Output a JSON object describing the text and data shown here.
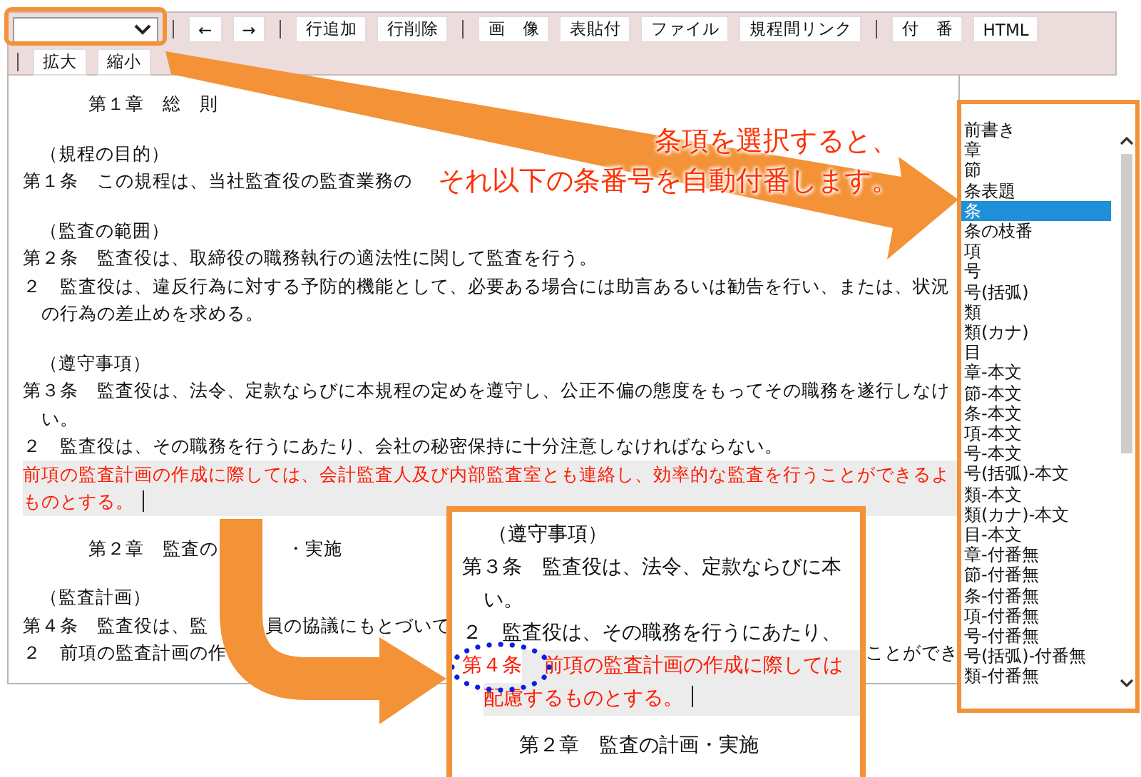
{
  "toolbar": {
    "rows": [
      [
        {
          "kind": "dropdown"
        },
        {
          "kind": "separator"
        },
        {
          "kind": "button",
          "label": "←"
        },
        {
          "kind": "button",
          "label": "→"
        },
        {
          "kind": "separator"
        },
        {
          "kind": "button",
          "label": "行追加"
        },
        {
          "kind": "button",
          "label": "行削除"
        },
        {
          "kind": "separator"
        },
        {
          "kind": "button",
          "label": "画　像"
        },
        {
          "kind": "button",
          "label": "表貼付"
        },
        {
          "kind": "button",
          "label": "ファイル"
        },
        {
          "kind": "button",
          "label": "規程間リンク"
        },
        {
          "kind": "separator"
        },
        {
          "kind": "button",
          "label": "付　番"
        },
        {
          "kind": "button",
          "label": "HTML"
        }
      ],
      [
        {
          "kind": "separator"
        },
        {
          "kind": "button",
          "label": "拡大"
        },
        {
          "kind": "button",
          "label": "縮小"
        }
      ]
    ]
  },
  "document": {
    "lines": [
      {
        "kind": "chapter",
        "parts": [
          "第１章　総　則"
        ]
      },
      {
        "kind": "caption",
        "parts": [
          "（規程の目的）"
        ]
      },
      {
        "kind": "article",
        "parts": [
          "第１条　この規程は、当社監査役の監査業務の"
        ]
      },
      {
        "kind": "caption",
        "parts": [
          "（監査の範囲）"
        ]
      },
      {
        "kind": "article",
        "parts": [
          "第２条　監査役は、取締役の職務執行の適法性に関して監査を行う。"
        ]
      },
      {
        "kind": "article",
        "parts": [
          "２　監査役は、違反行為に対する予防的機能として、必要ある場合には助言あるいは勧告を行い、または、状況"
        ]
      },
      {
        "kind": "continuation",
        "parts": [
          "の行為の差止めを求める。"
        ]
      },
      {
        "kind": "caption",
        "parts": [
          "（遵守事項）"
        ]
      },
      {
        "kind": "article",
        "parts": [
          "第３条　監査役は、法令、定款ならびに本規程の定めを遵守し、公正不偏の態度をもってその職務を遂行しなけ"
        ]
      },
      {
        "kind": "continuation",
        "parts": [
          "い。"
        ]
      },
      {
        "kind": "article",
        "parts": [
          "２　監査役は、その職務を行うにあたり、会社の秘密保持に十分注意しなければならない。"
        ]
      },
      {
        "kind": "highlight",
        "parts": [
          "前項の監査計画の作成に際しては、会計監査人及び内部監査室とも連絡し、効率的な監査を行うことができるよ"
        ]
      },
      {
        "kind": "highlight",
        "parts": [
          "ものとする。"
        ],
        "caret": true
      },
      {
        "kind": "chapter",
        "parts": [
          "第２章　監査の",
          "・実施"
        ]
      },
      {
        "kind": "caption",
        "parts": [
          "（監査計画）"
        ]
      },
      {
        "kind": "article",
        "parts": [
          "第４条　監査役は、監",
          "員の協議にもとづいて"
        ]
      },
      {
        "kind": "article",
        "parts": [
          "２　前項の監査計画の作",
          "ことができ"
        ]
      }
    ]
  },
  "callout": {
    "lines": [
      "条項を選択すると、",
      "それ以下の条番号を自動付番します。"
    ]
  },
  "listbox": {
    "items": [
      {
        "label": "前書き",
        "selected": false
      },
      {
        "label": "章",
        "selected": false
      },
      {
        "label": "節",
        "selected": false
      },
      {
        "label": "条表題",
        "selected": false
      },
      {
        "label": "条",
        "selected": true
      },
      {
        "label": "条の枝番",
        "selected": false
      },
      {
        "label": "項",
        "selected": false
      },
      {
        "label": "号",
        "selected": false
      },
      {
        "label": "号(括弧)",
        "selected": false
      },
      {
        "label": "類",
        "selected": false
      },
      {
        "label": "類(カナ)",
        "selected": false
      },
      {
        "label": "目",
        "selected": false
      },
      {
        "label": "章-本文",
        "selected": false
      },
      {
        "label": "節-本文",
        "selected": false
      },
      {
        "label": "条-本文",
        "selected": false
      },
      {
        "label": "項-本文",
        "selected": false
      },
      {
        "label": "号-本文",
        "selected": false
      },
      {
        "label": "号(括弧)-本文",
        "selected": false
      },
      {
        "label": "類-本文",
        "selected": false
      },
      {
        "label": "類(カナ)-本文",
        "selected": false
      },
      {
        "label": "目-本文",
        "selected": false
      },
      {
        "label": "章-付番無",
        "selected": false
      },
      {
        "label": "節-付番無",
        "selected": false
      },
      {
        "label": "条-付番無",
        "selected": false
      },
      {
        "label": "項-付番無",
        "selected": false
      },
      {
        "label": "号-付番無",
        "selected": false
      },
      {
        "label": "号(括弧)-付番無",
        "selected": false
      },
      {
        "label": "類-付番無",
        "selected": false
      }
    ]
  },
  "inset": {
    "lines": [
      {
        "kind": "caption",
        "parts": [
          "（遵守事項）"
        ]
      },
      {
        "kind": "article",
        "parts": [
          "第３条　監査役は、法令、定款ならびに本"
        ]
      },
      {
        "kind": "continuation",
        "parts": [
          "い。"
        ]
      },
      {
        "kind": "article",
        "parts": [
          "２　監査役は、その職務を行うにあたり、"
        ]
      },
      {
        "kind": "highlight",
        "number": "第４条",
        "parts": [
          "前項の監査計画の作成に際しては"
        ]
      },
      {
        "kind": "highlight",
        "parts": [
          "配慮するものとする。"
        ],
        "caret": true
      },
      {
        "kind": "chapter",
        "parts": [
          "第２章　監査の計画・実施"
        ]
      }
    ]
  }
}
